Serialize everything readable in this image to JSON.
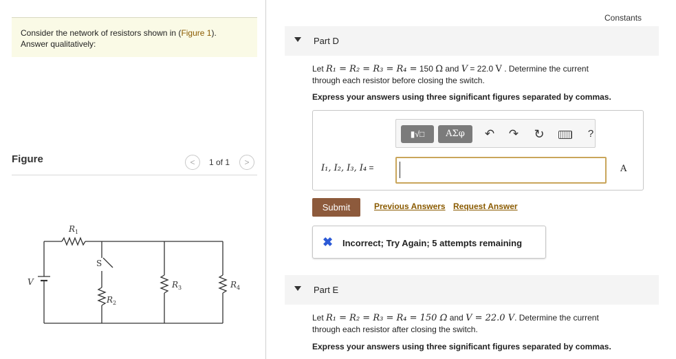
{
  "intro": {
    "text_before": "Consider the network of resistors shown in (",
    "figure_link": "Figure 1",
    "text_after": ").",
    "line2": "Answer qualitatively:"
  },
  "figure": {
    "title": "Figure",
    "page_count": "1 of 1",
    "prev_symbol": "<",
    "next_symbol": ">"
  },
  "circuit": {
    "r1": "R",
    "r1_sub": "1",
    "r2": "R",
    "r2_sub": "2",
    "r3": "R",
    "r3_sub": "3",
    "r4": "R",
    "r4_sub": "4",
    "switch": "S",
    "voltage": "V"
  },
  "constants_label": "Constants",
  "part_d": {
    "title": "Part D",
    "prompt_let": "Let ",
    "prompt_eq": "R₁ = R₂ = R₃ = R₄ =",
    "prompt_val": " 150 ",
    "prompt_ohm": "Ω",
    "prompt_and": " and ",
    "prompt_v": "V",
    "prompt_v_val": " = 22.0 ",
    "prompt_volt": "V",
    "prompt_rest": " . Determine the current",
    "prompt_line2": "through each resistor before closing the switch.",
    "instruction": "Express your answers using three significant figures separated by commas.",
    "toolbar": {
      "templates": "▮√□",
      "greek": "ΑΣφ",
      "undo": "↶",
      "redo": "↷",
      "reset": "↻",
      "help": "?"
    },
    "variables": "I₁, I₂, I₃, I₄",
    "equals": " =",
    "input_value": "",
    "unit": "A",
    "submit_label": "Submit",
    "previous_answers": "Previous Answers",
    "request_answer": "Request Answer",
    "feedback_icon": "✖",
    "feedback_text": "Incorrect; Try Again; 5 attempts remaining"
  },
  "part_e": {
    "title": "Part E",
    "prompt_let": "Let ",
    "prompt_eq": "R₁ = R₂ = R₃ = R₄ = 150 Ω",
    "prompt_and": " and ",
    "prompt_v": "V = 22.0 V",
    "prompt_rest": ". Determine the current",
    "prompt_line2": "through each resistor after closing the switch.",
    "instruction": "Express your answers using three significant figures separated by commas."
  },
  "colors": {
    "submit_bg": "#8d5a3c",
    "link": "#8a5a00",
    "input_border": "#c9a55a",
    "incorrect_icon": "#2c5ad6"
  }
}
